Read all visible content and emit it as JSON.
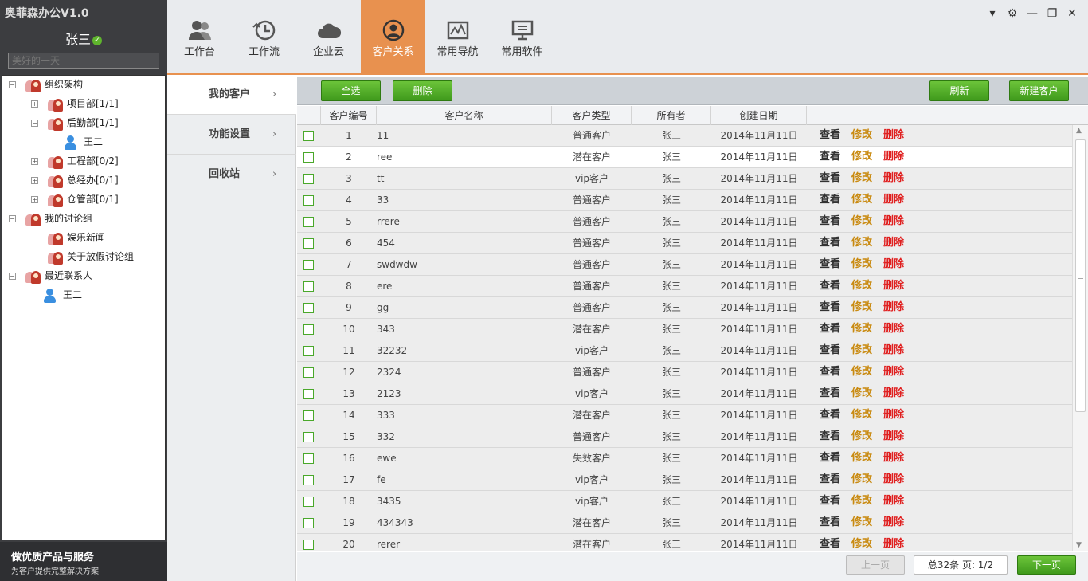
{
  "app": {
    "title": "奥菲森办公V1.0"
  },
  "user": {
    "name": "张三",
    "status_icon": "online-check-icon",
    "signature_placeholder": "美好的一天"
  },
  "tree": [
    {
      "label": "组织架构",
      "level": 0,
      "expander": "⊟",
      "icon": "group-icon"
    },
    {
      "label": "项目部[1/1]",
      "level": 1,
      "expander": "⊞",
      "icon": "group-icon"
    },
    {
      "label": "后勤部[1/1]",
      "level": 1,
      "expander": "⊟",
      "icon": "group-icon"
    },
    {
      "label": "王二",
      "level": 2,
      "expander": "",
      "icon": "person-icon"
    },
    {
      "label": "工程部[0/2]",
      "level": 1,
      "expander": "⊞",
      "icon": "group-icon"
    },
    {
      "label": "总经办[0/1]",
      "level": 1,
      "expander": "⊞",
      "icon": "group-icon"
    },
    {
      "label": "仓管部[0/1]",
      "level": 1,
      "expander": "⊞",
      "icon": "group-icon"
    },
    {
      "label": "我的讨论组",
      "level": 0,
      "expander": "⊟",
      "icon": "group-icon"
    },
    {
      "label": "娱乐新闻",
      "level": 1,
      "expander": "",
      "icon": "group-icon"
    },
    {
      "label": "关于放假讨论组",
      "level": 1,
      "expander": "",
      "icon": "group-icon"
    },
    {
      "label": "最近联系人",
      "level": 0,
      "expander": "⊟",
      "icon": "group-icon"
    },
    {
      "label": "王二",
      "level": 1,
      "expander": "",
      "icon": "person-icon"
    }
  ],
  "slogan": {
    "line1": "做优质产品与服务",
    "line2": "为客户提供完整解决方案"
  },
  "tabs": [
    {
      "label": "工作台",
      "icon": "workbench-icon"
    },
    {
      "label": "工作流",
      "icon": "workflow-clock-icon"
    },
    {
      "label": "企业云",
      "icon": "cloud-icon"
    },
    {
      "label": "客户关系",
      "icon": "customer-icon",
      "active": true
    },
    {
      "label": "常用导航",
      "icon": "navigation-chart-icon"
    },
    {
      "label": "常用软件",
      "icon": "software-monitor-icon"
    }
  ],
  "window_controls": [
    {
      "name": "dropdown-icon",
      "glyph": "▾"
    },
    {
      "name": "gear-icon",
      "glyph": "⚙"
    },
    {
      "name": "minimize-icon",
      "glyph": "—"
    },
    {
      "name": "restore-icon",
      "glyph": "❐"
    },
    {
      "name": "close-icon",
      "glyph": "✕"
    }
  ],
  "menu": [
    {
      "label": "我的客户",
      "active": true
    },
    {
      "label": "功能设置"
    },
    {
      "label": "回收站"
    }
  ],
  "menu_chevron": "›",
  "toolbar": {
    "select_all": "全选",
    "delete": "删除",
    "refresh": "刷新",
    "new_customer": "新建客户"
  },
  "table": {
    "headers": [
      "客户编号",
      "客户名称",
      "客户类型",
      "所有者",
      "创建日期"
    ],
    "actions": {
      "view": "查看",
      "edit": "修改",
      "delete": "删除"
    },
    "rows": [
      [
        "1",
        "11",
        "普通客户",
        "张三",
        "2014年11月11日"
      ],
      [
        "2",
        "ree",
        "潜在客户",
        "张三",
        "2014年11月11日"
      ],
      [
        "3",
        "tt",
        "vip客户",
        "张三",
        "2014年11月11日"
      ],
      [
        "4",
        "33",
        "普通客户",
        "张三",
        "2014年11月11日"
      ],
      [
        "5",
        "rrere",
        "普通客户",
        "张三",
        "2014年11月11日"
      ],
      [
        "6",
        "454",
        "普通客户",
        "张三",
        "2014年11月11日"
      ],
      [
        "7",
        "swdwdw",
        "普通客户",
        "张三",
        "2014年11月11日"
      ],
      [
        "8",
        "ere",
        "普通客户",
        "张三",
        "2014年11月11日"
      ],
      [
        "9",
        "gg",
        "普通客户",
        "张三",
        "2014年11月11日"
      ],
      [
        "10",
        "343",
        "潜在客户",
        "张三",
        "2014年11月11日"
      ],
      [
        "11",
        "32232",
        "vip客户",
        "张三",
        "2014年11月11日"
      ],
      [
        "12",
        "2324",
        "普通客户",
        "张三",
        "2014年11月11日"
      ],
      [
        "13",
        "2123",
        "vip客户",
        "张三",
        "2014年11月11日"
      ],
      [
        "14",
        "333",
        "潜在客户",
        "张三",
        "2014年11月11日"
      ],
      [
        "15",
        "332",
        "普通客户",
        "张三",
        "2014年11月11日"
      ],
      [
        "16",
        "ewe",
        "失效客户",
        "张三",
        "2014年11月11日"
      ],
      [
        "17",
        "fe",
        "vip客户",
        "张三",
        "2014年11月11日"
      ],
      [
        "18",
        "3435",
        "vip客户",
        "张三",
        "2014年11月11日"
      ],
      [
        "19",
        "434343",
        "潜在客户",
        "张三",
        "2014年11月11日"
      ],
      [
        "20",
        "rerer",
        "潜在客户",
        "张三",
        "2014年11月11日"
      ]
    ]
  },
  "pager": {
    "prev": "上一页",
    "info": "总32条 页: 1/2",
    "next": "下一页"
  },
  "colors": {
    "accent": "#e8914f",
    "green": "#4fae27",
    "dark": "#3c3d40",
    "edit": "#c98a10",
    "delete": "#e02020"
  }
}
